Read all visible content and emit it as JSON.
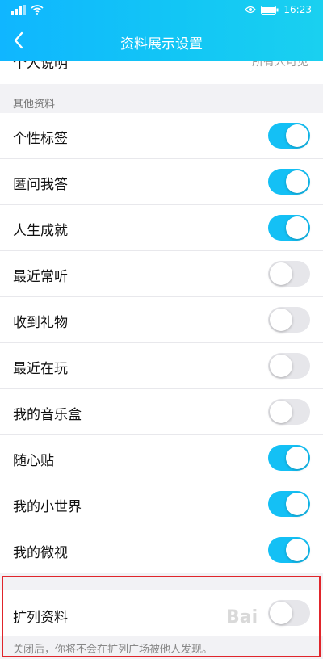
{
  "statusbar": {
    "time": "16:23",
    "battery_level": "high"
  },
  "header": {
    "title": "资料展示设置"
  },
  "partial_row": {
    "label": "个人说明",
    "value": "所有人可见"
  },
  "section": {
    "title": "其他资料"
  },
  "rows": [
    {
      "label": "个性标签",
      "on": true
    },
    {
      "label": "匿问我答",
      "on": true
    },
    {
      "label": "人生成就",
      "on": true
    },
    {
      "label": "最近常听",
      "on": false
    },
    {
      "label": "收到礼物",
      "on": false
    },
    {
      "label": "最近在玩",
      "on": false
    },
    {
      "label": "我的音乐盒",
      "on": false
    },
    {
      "label": "随心贴",
      "on": true
    },
    {
      "label": "我的小世界",
      "on": true
    },
    {
      "label": "我的微视",
      "on": true
    }
  ],
  "extended": {
    "label": "扩列资料",
    "on": false,
    "note": "关闭后，你将不会在扩列广场被他人发现。"
  },
  "colors": {
    "accent": "#14c0f5",
    "highlight": "#e0252b",
    "off": "#e6e6ea"
  },
  "watermark": "Bai"
}
